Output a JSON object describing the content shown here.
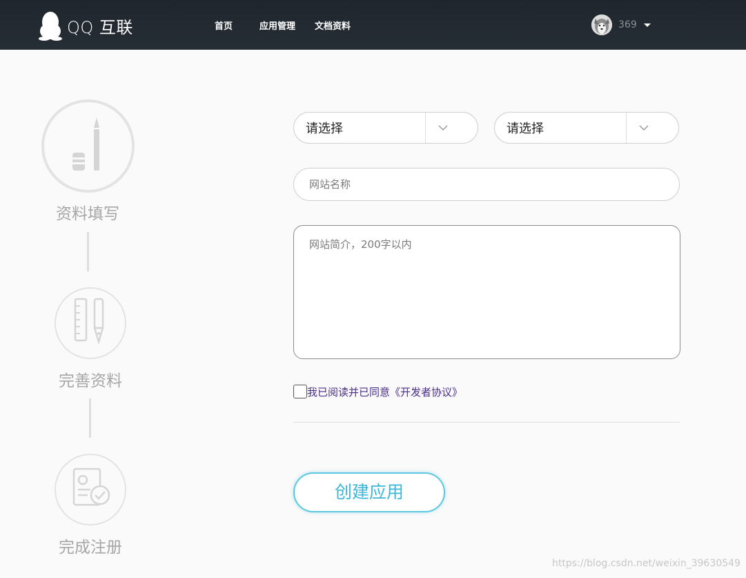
{
  "header": {
    "logo_text": "QQ 互联",
    "logo_icon": "penguin-icon",
    "nav": [
      {
        "label": "首页"
      },
      {
        "label": "应用管理"
      },
      {
        "label": "文档资料"
      }
    ],
    "user": {
      "name": "369",
      "avatar_icon": "husky-avatar",
      "menu_icon": "caret-down-icon"
    }
  },
  "steps": [
    {
      "label": "资料填写",
      "icon": "pencil-eraser-icon"
    },
    {
      "label": "完善资料",
      "icon": "ruler-pen-icon"
    },
    {
      "label": "完成注册",
      "icon": "id-card-check-icon"
    }
  ],
  "form": {
    "select1": {
      "value": "请选择",
      "icon": "chevron-down-icon"
    },
    "select2": {
      "value": "请选择",
      "icon": "chevron-down-icon"
    },
    "site_name": {
      "placeholder": "网站名称",
      "value": ""
    },
    "site_description": {
      "placeholder": "网站简介，200字以内",
      "value": ""
    },
    "agreement": {
      "label": "我已阅读并已同意《开发者协议》",
      "checked": false
    },
    "create_button": "创建应用"
  },
  "watermark": "https://blog.csdn.net/weixin_39630549",
  "colors": {
    "header_bg": "#222a31",
    "accent": "#3cb6d9",
    "agreement_text": "#4a2e8a",
    "step_gray": "#a6a6a6"
  }
}
